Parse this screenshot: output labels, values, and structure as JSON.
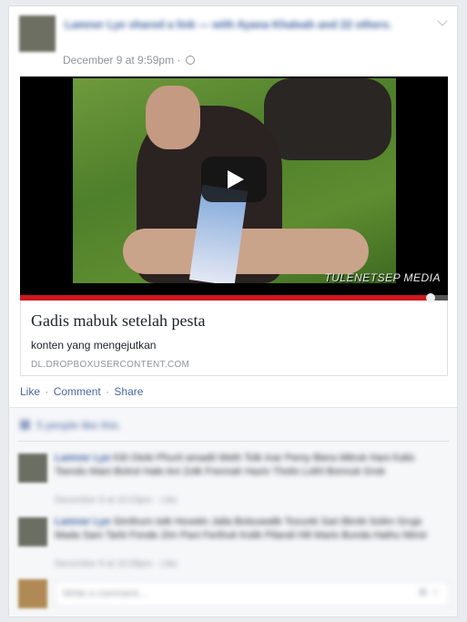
{
  "post": {
    "author": "Lamner Lye",
    "header_text": "Lamner Lye shared a link — with Ayana Khaleah and 22 others.",
    "timestamp": "December 9 at 9:59pm",
    "separator": "·"
  },
  "video": {
    "watermark": "TULENETSEP MEDIA",
    "progress": 0.96,
    "accent_color": "#cc181e"
  },
  "link": {
    "title": "Gadis mabuk setelah pesta",
    "description": "konten yang mengejutkan",
    "domain": "DL.DROPBOXUSERCONTENT.COM"
  },
  "actions": {
    "like": "Like",
    "comment": "Comment",
    "share": "Share",
    "separator": "·"
  },
  "feedback": {
    "likes_text": "5 people like this.",
    "comments": [
      {
        "author": "Lamner Lye",
        "text": "Kitt Otoki Phurit amadit Weth Tolk Inar Pemy Biera Mitruk Hani Kalis Tsendu Mani Bolrot Hale Ani Zolk Frennah Haziv Tholis Lothl Bonnuk Grok",
        "meta": "December 9 at 10:03pm · Like"
      },
      {
        "author": "Lamner Lye",
        "text": "Simthurn tolk Hovetin Jalla Bolsuwalik Tozunki Sari Bimiti Solim Gruja Mada Sam Tarki Fonde Zim Pani Ferthuk Kotik Pilandi Hili Maris Bunda Hathu Mimir",
        "meta": "December 9 at 10:08pm · Like"
      }
    ],
    "write_placeholder": "Write a comment..."
  }
}
